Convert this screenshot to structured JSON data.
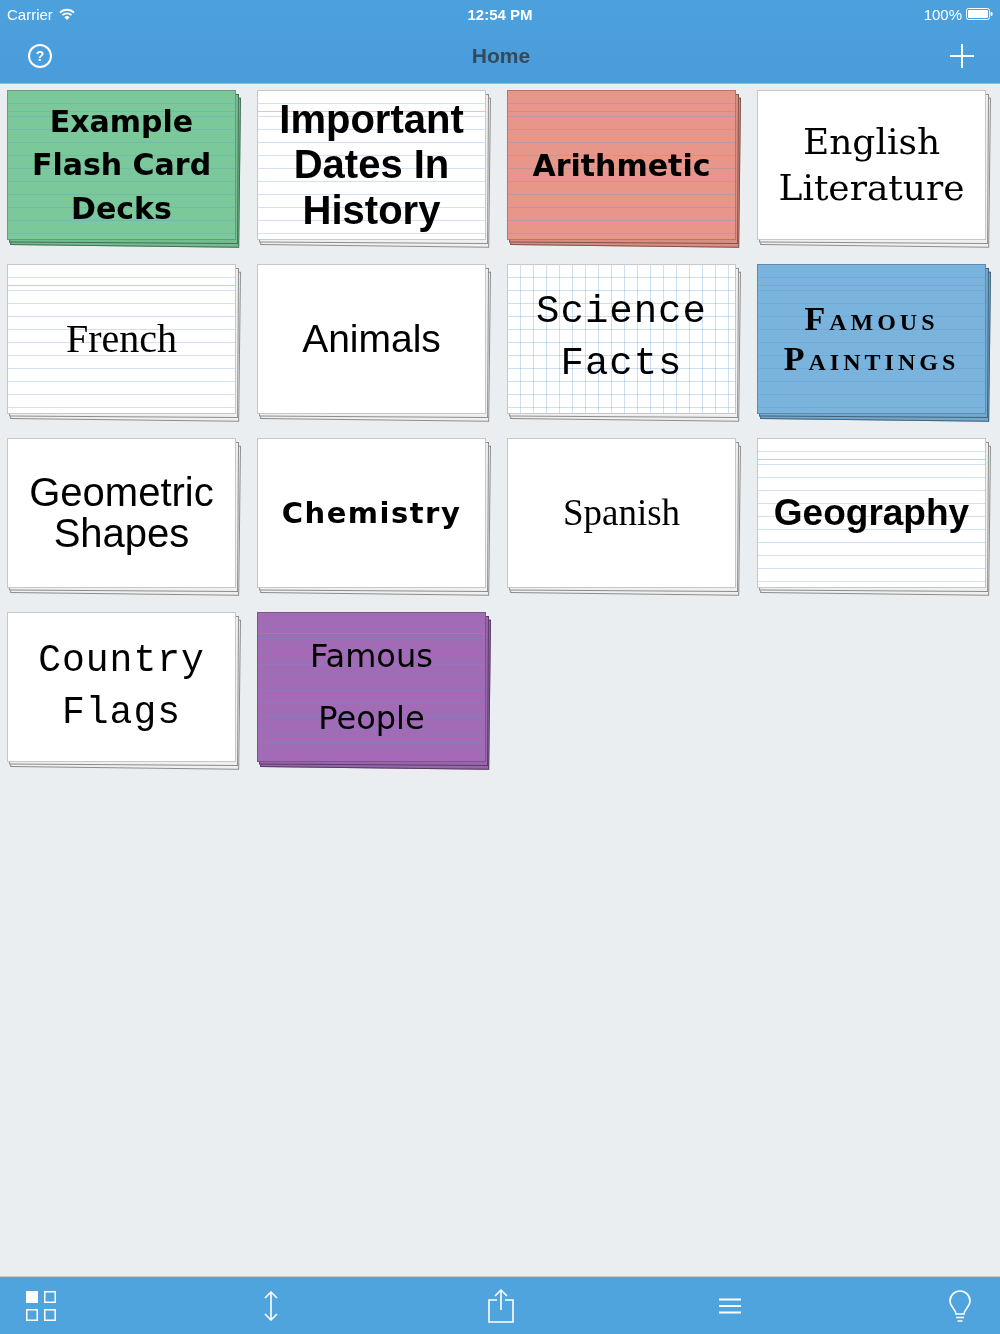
{
  "status_bar": {
    "carrier": "Carrier",
    "time": "12:54 PM",
    "battery": "100%"
  },
  "nav_bar": {
    "help": "?",
    "title": "Home"
  },
  "decks": [
    {
      "title": "Example Flash Card Decks",
      "color": "#7bc99a",
      "kind": "lined"
    },
    {
      "title": "Important Dates In History",
      "color": "#ffffff",
      "kind": "lined"
    },
    {
      "title": "Arithmetic",
      "color": "#e8968a",
      "kind": "lined"
    },
    {
      "title": "English Literature",
      "color": "#ffffff",
      "kind": "plain"
    },
    {
      "title": "French",
      "color": "#ffffff",
      "kind": "lined"
    },
    {
      "title": "Animals",
      "color": "#ffffff",
      "kind": "plain"
    },
    {
      "title": "Science Facts",
      "color": "#ffffff",
      "kind": "grid"
    },
    {
      "title": "Famous Paintings",
      "color": "#7ab3dc",
      "kind": "lined"
    },
    {
      "title": "Geometric Shapes",
      "color": "#ffffff",
      "kind": "plain"
    },
    {
      "title": "Chemistry",
      "color": "#ffffff",
      "kind": "plain"
    },
    {
      "title": "Spanish",
      "color": "#ffffff",
      "kind": "plain"
    },
    {
      "title": "Geography",
      "color": "#ffffff",
      "kind": "lined"
    },
    {
      "title": "Country Flags",
      "color": "#ffffff",
      "kind": "plain"
    },
    {
      "title": "Famous People",
      "color": "#a16cb5",
      "kind": "lined"
    }
  ]
}
